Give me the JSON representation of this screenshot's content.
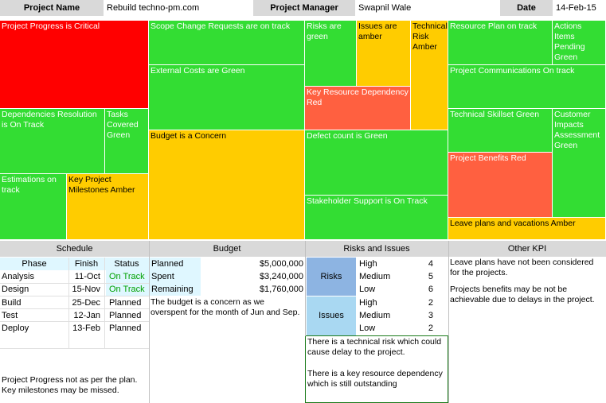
{
  "header": {
    "project_name_label": "Project Name",
    "project_name_value": "Rebuild techno-pm.com",
    "manager_label": "Project Manager",
    "manager_value": "Swapnil Wale",
    "date_label": "Date",
    "date_value": "14-Feb-15"
  },
  "tiles": {
    "progress": "Project Progress is Critical",
    "dependencies": "Dependencies Resolution is On Track",
    "tasks_covered": "Tasks Covered Green",
    "estimations": "Estimations on track",
    "key_milestones": "Key Project Milestones Amber",
    "scope_change": "Scope Change Requests are on track",
    "external_costs": "External Costs are Green",
    "budget": "Budget is a Concern",
    "risks_green": "Risks are green",
    "issues_amber": "Issues are amber",
    "technical_risk": "Technical Risk Amber",
    "key_resource": "Key Resource Dependency Red",
    "defect_count": "Defect count is Green",
    "stakeholder": "Stakeholder Support is On Track",
    "resource_plan": "Resource Plan on track",
    "actions_items": "Actions Items Pending Green",
    "communications": "Project Communications On track",
    "skillset": "Technical Skillset Green",
    "customer_impacts": "Customer Impacts Assessment Green",
    "benefits": "Project Benefits Red",
    "leave_plans": "Leave plans and vacations Amber"
  },
  "schedule": {
    "title": "Schedule",
    "columns": [
      "Phase",
      "Finish",
      "Status"
    ],
    "rows": [
      {
        "phase": "Analysis",
        "finish": "11-Oct",
        "status": "On Track"
      },
      {
        "phase": "Design",
        "finish": "15-Nov",
        "status": "On Track"
      },
      {
        "phase": "Build",
        "finish": "25-Dec",
        "status": "Planned"
      },
      {
        "phase": "Test",
        "finish": "12-Jan",
        "status": "Planned"
      },
      {
        "phase": "Deploy",
        "finish": "13-Feb",
        "status": "Planned"
      }
    ],
    "note": "Project Progress not as per the plan. Key milestones may be missed."
  },
  "budget": {
    "title": "Budget",
    "rows": [
      {
        "label": "Planned",
        "value": "$5,000,000"
      },
      {
        "label": "Spent",
        "value": "$3,240,000"
      },
      {
        "label": "Remaining",
        "value": "$1,760,000"
      }
    ],
    "note": "The budget is a concern as we overspent for the month of Jun and Sep."
  },
  "risks_issues": {
    "title": "Risks and Issues",
    "risks_label": "Risks",
    "issues_label": "Issues",
    "risks": [
      {
        "level": "High",
        "count": "4"
      },
      {
        "level": "Medium",
        "count": "5"
      },
      {
        "level": "Low",
        "count": "6"
      }
    ],
    "issues": [
      {
        "level": "High",
        "count": "2"
      },
      {
        "level": "Medium",
        "count": "3"
      },
      {
        "level": "Low",
        "count": "2"
      }
    ],
    "note1": "There is a technical risk which could cause delay to the project.",
    "note2": "There is a key resource dependency which is still outstanding"
  },
  "other_kpi": {
    "title": "Other KPI",
    "note1": "Leave plans have not been considered for the projects.",
    "note2": "Projects benefits may be not be achievable due to delays in the project."
  },
  "colors": {
    "green": "#33dd33",
    "red": "#ff0000",
    "amber": "#ffcc00",
    "orange_red": "#ff6040"
  }
}
